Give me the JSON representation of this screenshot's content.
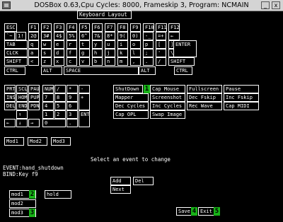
{
  "window": {
    "title": "DOSBox 0.63,Cpu Cycles:     8000, Frameskip  3, Program:   NCMAIN",
    "minimize": "_",
    "close": "x"
  },
  "header": {
    "keyboard_layout": "Keyboard Layout"
  },
  "keys": {
    "esc": "ESC",
    "f1": "F1",
    "f2": "F2",
    "f3": "F3",
    "f4": "F4",
    "f5": "F5",
    "f6": "F6",
    "f7": "F7",
    "f8": "F8",
    "f9": "F9",
    "f10": "F10",
    "f11": "F11",
    "f12": "F12",
    "grave": "`~",
    "n1": "1!",
    "n2": "2@",
    "n3": "3#",
    "n4": "4$",
    "n5": "5%",
    "n6": "6^",
    "n7": "7&",
    "n8": "8*",
    "n9": "9(",
    "n0": "0)",
    "minus": "-_",
    "equal": "=+",
    "bksp": "←",
    "tab": "TAB",
    "q": "q",
    "w": "w",
    "e": "e",
    "r": "r",
    "t": "t",
    "y": "y",
    "u": "u",
    "i": "i",
    "o": "o",
    "p": "p",
    "lbr": "[",
    "rbr": "]",
    "enter": "ENTER",
    "caps": "CLCK",
    "a": "a",
    "s": "s",
    "d": "d",
    "f": "f",
    "g": "g",
    "h": "h",
    "j": "j",
    "k": "k",
    "l": "l",
    "semi": ";",
    "quote": "'",
    "bslash": "\\",
    "lshift": "SHIFT",
    "lt": "<",
    "z": "z",
    "x": "x",
    "c": "c",
    "v": "v",
    "b": "b",
    "n": "n",
    "m": "m",
    "comma": ",",
    "period": ".",
    "slash": "/",
    "rshift": "SHIFT",
    "lctrl": "CTRL",
    "lalt": "ALT",
    "space": "SPACE",
    "ralt": "ALT",
    "rctrl": "CTRL",
    "prt": "PRT",
    "scl": "SCL",
    "pau": "PAU",
    "ins": "INS",
    "hom": "HOM",
    "pup": "PUP",
    "del": "DEL",
    "end": "END",
    "pdn": "PDN",
    "up": "↑",
    "left": "←",
    "down": "↓",
    "right": "→",
    "num": "NUM",
    "kdiv": "/",
    "kmul": "*",
    "ksub": "-",
    "k7": "7",
    "k8": "8",
    "k9": "9",
    "kadd": "+",
    "k4": "4",
    "k5": "5",
    "k6": "6",
    "k1": "1",
    "k2": "2",
    "k3": "3",
    "kent": "ENT",
    "k0": "0",
    "kdot": "."
  },
  "events": {
    "shutdown": "ShutDown",
    "capmouse": "Cap Mouse",
    "fullscreen": "Fullscreen",
    "pause": "Pause",
    "mapper": "Mapper",
    "screenshot": "Screenshot",
    "decfskip": "Dec Fskip",
    "incfskip": "Inc Fskip",
    "deccycles": "Dec Cycles",
    "inccycles": "Inc Cycles",
    "recwave": "Rec Wave",
    "capmidi": "Cap MIDI",
    "capopl": "Cap OPL",
    "swapimage": "Swap Image"
  },
  "mods": {
    "mod1": "Mod1",
    "mod2": "Mod2",
    "mod3": "Mod3"
  },
  "prompt": "Select an event to change",
  "event_line": "EVENT:hand_shutdown",
  "bind_line": "BIND:Key f9",
  "bind_buttons": {
    "add": "Add",
    "del": "Del",
    "next": "Next"
  },
  "modifiers": {
    "mod1": "mod1",
    "hold": "hold",
    "mod2": "mod2",
    "mod3": "mod3"
  },
  "footer": {
    "save": "Save",
    "exit": "Exit"
  },
  "badges": {
    "b1": "1",
    "b2": "2",
    "b3": "3",
    "b4": "4",
    "b5": "5"
  },
  "colors": {
    "background": "#000000",
    "text": "#ffffff",
    "badge": "#17b217",
    "titlebar": "#d4d4d4"
  }
}
